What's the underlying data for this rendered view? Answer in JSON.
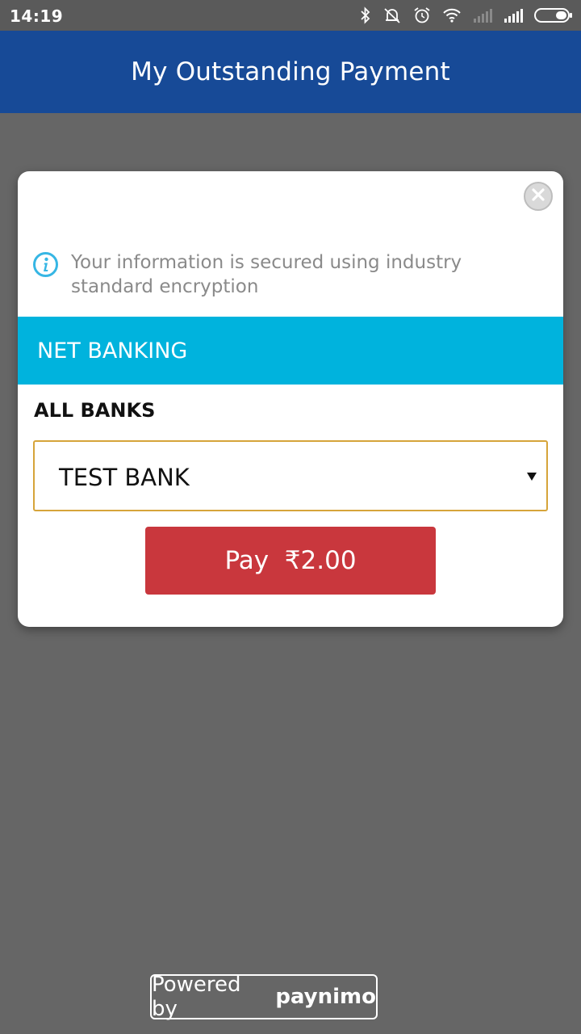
{
  "status_bar": {
    "time": "14:19",
    "icons": [
      "bluetooth-icon",
      "alarm-off-icon",
      "alarm-clock-icon",
      "wifi-icon",
      "signal-weak-icon",
      "signal-full-icon",
      "battery-icon"
    ]
  },
  "app_bar": {
    "title": "My Outstanding Payment"
  },
  "modal": {
    "close_icon": "close-icon",
    "info_icon": "info-icon",
    "info_text": "Your information is secured using industry standard encryption",
    "section_title": "NET BANKING",
    "banks_label": "ALL BANKS",
    "bank_select": {
      "selected": "TEST BANK",
      "chevron": "dropdown-arrow-icon"
    },
    "pay_button": {
      "label": "Pay  ₹2.00"
    }
  },
  "footer": {
    "powered_by": "Powered by",
    "brand": "paynimo"
  },
  "colors": {
    "app_bar": "#174a97",
    "section_header": "#00b3dd",
    "pay_button": "#c9373d",
    "select_border": "#d6a43a",
    "backdrop": "#666666"
  }
}
